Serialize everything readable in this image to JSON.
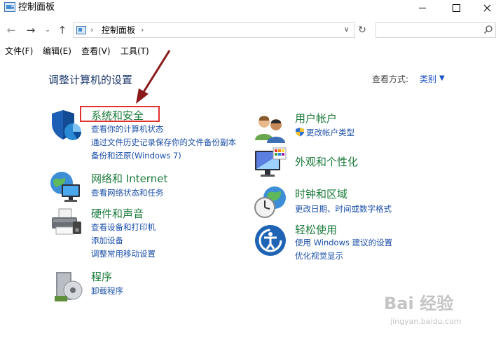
{
  "window": {
    "title": "控制面板",
    "minimize_icon": "minimize-icon",
    "maximize_icon": "maximize-icon",
    "close_icon": "close-icon"
  },
  "address_bar": {
    "breadcrumb": "控制面板",
    "search_placeholder": ""
  },
  "menu": {
    "file": "文件(F)",
    "edit": "编辑(E)",
    "view": "查看(V)",
    "tools": "工具(T)"
  },
  "content": {
    "page_title": "调整计算机的设置",
    "view_by_label": "查看方式:",
    "view_by_value": "类别"
  },
  "categories_left": [
    {
      "title": "系统和安全",
      "icon": "shield-icon",
      "links": [
        "查看你的计算机状态",
        "通过文件历史记录保存你的文件备份副本",
        "备份和还原(Windows 7)"
      ]
    },
    {
      "title": "网络和 Internet",
      "icon": "network-globe-icon",
      "links": [
        "查看网络状态和任务"
      ]
    },
    {
      "title": "硬件和声音",
      "icon": "printer-icon",
      "links": [
        "查看设备和打印机",
        "添加设备",
        "调整常用移动设置"
      ]
    },
    {
      "title": "程序",
      "icon": "programs-disc-icon",
      "links": [
        "卸载程序"
      ]
    }
  ],
  "categories_right": [
    {
      "title": "用户帐户",
      "icon": "users-icon",
      "links": [
        "更改帐户类型"
      ]
    },
    {
      "title": "外观和个性化",
      "icon": "monitor-palette-icon",
      "links": []
    },
    {
      "title": "时钟和区域",
      "icon": "clock-globe-icon",
      "links": [
        "更改日期、时间或数字格式"
      ]
    },
    {
      "title": "轻松使用",
      "icon": "ease-of-access-icon",
      "links": [
        "使用 Windows 建议的设置",
        "优化视觉显示"
      ]
    }
  ],
  "watermark": {
    "logo": "Bai 经验",
    "url": "jingyan.baidu.com"
  },
  "colors": {
    "category_title": "#1a7a3a",
    "link": "#1a4fa8",
    "highlight": "#e0322e",
    "annotation_arrow": "#8b1a1a"
  }
}
